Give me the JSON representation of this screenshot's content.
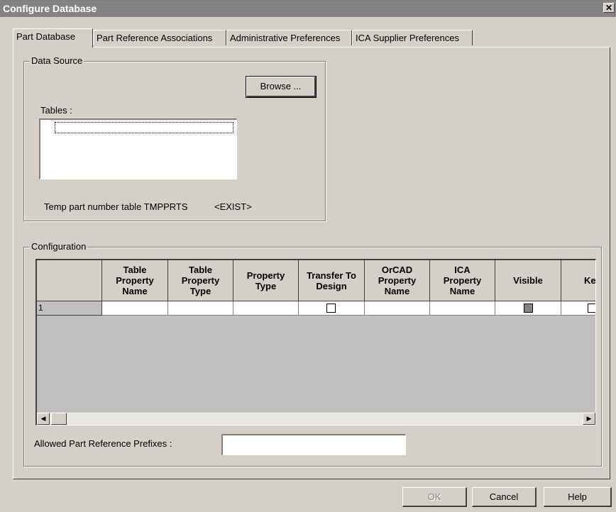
{
  "window": {
    "title": "Configure Database",
    "close_glyph": "✕"
  },
  "tabs": [
    {
      "label": "Part Database",
      "active": true
    },
    {
      "label": "Part Reference Associations",
      "active": false
    },
    {
      "label": "Administrative Preferences",
      "active": false
    },
    {
      "label": "ICA Supplier Preferences",
      "active": false
    }
  ],
  "data_source": {
    "group_label": "Data Source",
    "browse_label": "Browse ...",
    "tables_label": "Tables :",
    "temp_table_text": "Temp part number table TMPPRTS",
    "exist_text": "<EXIST>"
  },
  "configuration": {
    "group_label": "Configuration",
    "columns": [
      "Table\nProperty\nName",
      "Table\nProperty\nType",
      "Property\nType",
      "Transfer To\nDesign",
      "OrCAD\nProperty\nName",
      "ICA\nProperty\nName",
      "Visible",
      "Ke"
    ],
    "rows": [
      {
        "row_number": "1",
        "transfer_to_design": false,
        "visible": "indeterminate",
        "key": false
      }
    ],
    "prefixes_label": "Allowed Part Reference Prefixes :",
    "prefixes_value": ""
  },
  "buttons": {
    "ok": "OK",
    "cancel": "Cancel",
    "help": "Help"
  },
  "icons": {
    "scroll_left": "◀",
    "scroll_right": "▶"
  }
}
